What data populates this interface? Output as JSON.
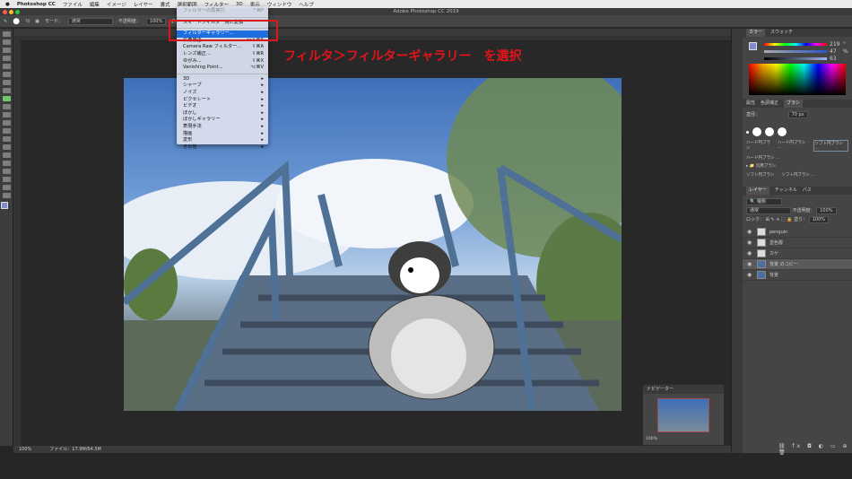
{
  "menubar": {
    "app": "Photoshop CC",
    "items": [
      "ファイル",
      "編集",
      "イメージ",
      "レイヤー",
      "書式",
      "選択範囲",
      "フィルター",
      "3D",
      "表示",
      "ウィンドウ",
      "ヘルプ"
    ]
  },
  "window_title": "Adobe Photoshop CC 2019",
  "options": {
    "brush_size": "70",
    "mode_label": "モード：",
    "mode_value": "通常",
    "opacity_label": "不透明度：",
    "opacity_value": "100%"
  },
  "filter_menu": {
    "top": [
      {
        "label": "フィルターの再実行",
        "shortcut": "^⌘F",
        "disabled": true
      },
      {
        "label": "スマートフィルター用に変換",
        "shortcut": ""
      },
      {
        "label": "フィルターギャラリー...",
        "shortcut": "",
        "highlighted": true
      },
      {
        "label": "広角補正...",
        "shortcut": "⌥⇧⌘A"
      },
      {
        "label": "Camera Raw フィルター...",
        "shortcut": "⇧⌘A"
      },
      {
        "label": "レンズ補正...",
        "shortcut": "⇧⌘R"
      },
      {
        "label": "ゆがみ...",
        "shortcut": "⇧⌘X"
      },
      {
        "label": "Vanishing Point...",
        "shortcut": "⌥⌘V"
      }
    ],
    "sub": [
      "3D",
      "シャープ",
      "ノイズ",
      "ピクセレート",
      "ビデオ",
      "ぼかし",
      "ぼかしギャラリー",
      "表現手法",
      "描画",
      "変形",
      "その他"
    ]
  },
  "callout": "フィルタ＞フィルターギャラリー　を選択",
  "status": {
    "zoom": "100%",
    "file": "ファイル：17.9M/64.5M"
  },
  "color_panel": {
    "tabs": [
      "カラー",
      "スウォッチ"
    ],
    "h": "219",
    "s": "47",
    "b": "63",
    "h_unit": "°",
    "pct": "%"
  },
  "brush_panel": {
    "tabs": [
      "属性",
      "色調補正",
      "ブラシ"
    ],
    "size_label": "直径：",
    "size": "70 px",
    "presets": [
      "ハード円ブラシ",
      "ハード円ブラシ ...",
      "ソフト円ブラシ ...",
      "ハード円ブラシ ..."
    ],
    "group": "汎用ブラシ",
    "group_items": [
      "ソフト円ブラシ",
      "ソフト円ブラシ ..."
    ]
  },
  "layers_panel": {
    "tabs": [
      "レイヤー",
      "チャンネル",
      "パス"
    ],
    "filter": "種類",
    "blend": "通常",
    "opacity_label": "不透明度：",
    "opacity": "100%",
    "lock_label": "ロック：",
    "fill_label": "塗り：",
    "fill": "100%",
    "layers": [
      {
        "name": "penguin"
      },
      {
        "name": "塗色層"
      },
      {
        "name": "カゲ"
      },
      {
        "name": "背景 のコピー",
        "selected": true
      },
      {
        "name": "背景"
      }
    ]
  },
  "navigator": {
    "title": "ナビゲーター",
    "zoom": "100%"
  }
}
